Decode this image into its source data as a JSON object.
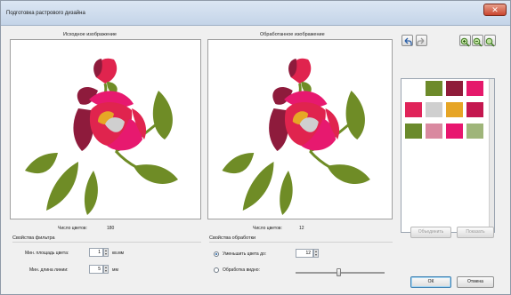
{
  "window": {
    "title": "Подготовка растрового дизайна",
    "close_glyph": "✕"
  },
  "left_panel": {
    "title": "Исходное изображение",
    "colors_label": "Число цветов:",
    "colors_value": "180"
  },
  "right_panel": {
    "title": "Обработанное изображение",
    "colors_label": "Число цветов:",
    "colors_value": "12"
  },
  "filter": {
    "group_label": "Свойства фильтра",
    "min_area_label": "Мин. площадь цвета:",
    "min_area_value": "1",
    "min_area_unit": "кв.мм",
    "min_line_label": "Мин. длина линии:",
    "min_line_value": "5",
    "min_line_unit": "мм"
  },
  "processing": {
    "group_label": "Свойства обработки",
    "reduce_label": "Уменьшить цвета до:",
    "reduce_value": "12",
    "visual_label": "Обработка видно:"
  },
  "toolbar": {
    "undo_icon": "undo-icon",
    "redo_icon": "redo-icon",
    "zoom_in_icon": "zoom-in-icon",
    "zoom_out_icon": "zoom-out-icon",
    "zoom_fit_icon": "zoom-fit-icon"
  },
  "palette_colors": [
    "#6d8a2a",
    "#8f1c3a",
    "#e5196b",
    "#e0245a",
    "#cfcfcf",
    "#e6a526",
    "#c4174f",
    "#6a8a2c",
    "#d989a0",
    "#e8166f",
    "#9fb57a"
  ],
  "buttons": {
    "merge": "Объединить",
    "show": "Показать",
    "ok": "ОК",
    "cancel": "Отмена"
  },
  "flower_colors": {
    "leaf": "#6f8c26",
    "petal_red": "#e0244e",
    "petal_pink": "#e7196f",
    "petal_dark": "#8e1b3c",
    "center_yellow": "#e6a726",
    "center_gray": "#cfcfcf"
  }
}
